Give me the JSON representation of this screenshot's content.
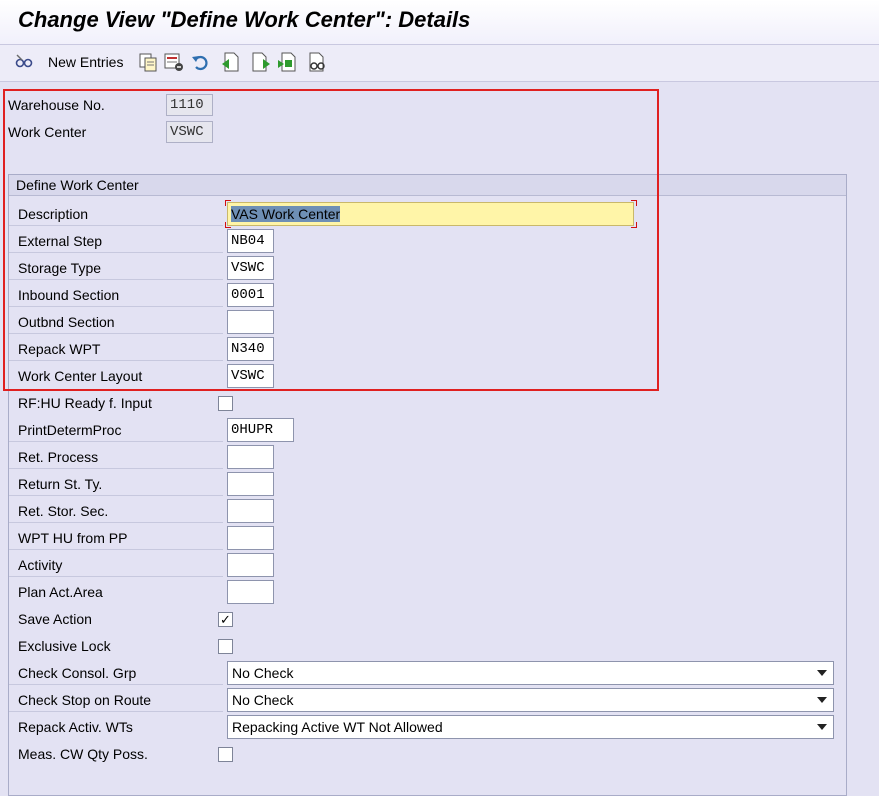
{
  "title": "Change View \"Define Work Center\": Details",
  "toolbar": {
    "new_entries_label": "New Entries",
    "icons": [
      "edit-glasses-icon",
      "copy-icon",
      "delete-icon",
      "undo-icon",
      "previous-entry-icon",
      "next-entry-icon",
      "transport-icon",
      "other-entry-icon"
    ]
  },
  "header": {
    "warehouse_label": "Warehouse No.",
    "warehouse_value": "1110",
    "workcenter_label": "Work Center",
    "workcenter_value": "VSWC"
  },
  "group": {
    "title": "Define Work Center",
    "description_label": "Description",
    "description_value": "VAS Work Center",
    "external_step_label": "External Step",
    "external_step_value": "NB04",
    "storage_type_label": "Storage Type",
    "storage_type_value": "VSWC",
    "inbound_section_label": "Inbound Section",
    "inbound_section_value": "0001",
    "outbnd_section_label": "Outbnd Section",
    "outbnd_section_value": "",
    "repack_wpt_label": "Repack WPT",
    "repack_wpt_value": "N340",
    "work_center_layout_label": "Work Center Layout",
    "work_center_layout_value": "VSWC",
    "rf_hu_ready_label": "RF:HU Ready f. Input",
    "rf_hu_ready_checked": false,
    "print_determ_label": "PrintDetermProc",
    "print_determ_value": "0HUPR",
    "ret_process_label": "Ret. Process",
    "ret_process_value": "",
    "return_st_ty_label": "Return St. Ty.",
    "return_st_ty_value": "",
    "ret_stor_sec_label": "Ret. Stor. Sec.",
    "ret_stor_sec_value": "",
    "wpt_hu_from_pp_label": "WPT HU from PP",
    "wpt_hu_from_pp_value": "",
    "activity_label": "Activity",
    "activity_value": "",
    "plan_act_area_label": "Plan Act.Area",
    "plan_act_area_value": "",
    "save_action_label": "Save Action",
    "save_action_check": "✓",
    "exclusive_lock_label": "Exclusive Lock",
    "exclusive_lock_checked": false,
    "check_consol_grp_label": "Check Consol. Grp",
    "check_consol_grp_value": "No Check",
    "check_stop_route_label": "Check Stop on Route",
    "check_stop_route_value": "No Check",
    "repack_activ_wts_label": "Repack Activ. WTs",
    "repack_activ_wts_value": "Repacking Active WT Not Allowed",
    "meas_cw_qty_label": "Meas. CW Qty Poss.",
    "meas_cw_qty_checked": false
  },
  "colors": {
    "background": "#e3e2f3",
    "highlight_field": "#fff5a8",
    "annotation_box": "#e02020"
  }
}
